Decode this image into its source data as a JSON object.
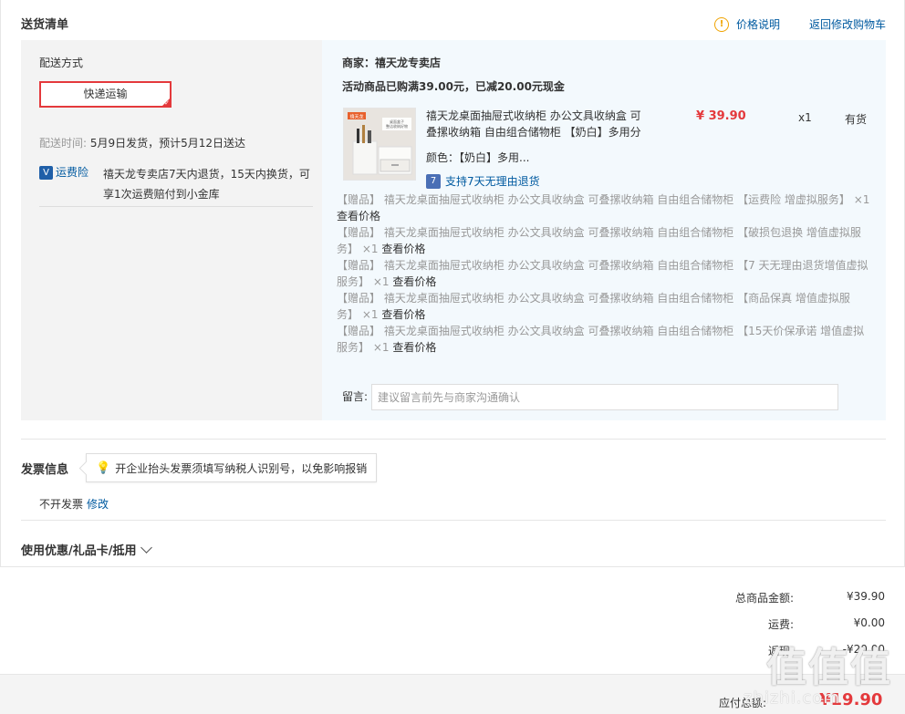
{
  "header": {
    "title": "送货清单",
    "price_info": "价格说明",
    "back_cart": "返回修改购物车"
  },
  "shipping": {
    "label": "配送方式",
    "method": "快递运输",
    "time_label": "配送时间:",
    "time_value": "5月9日发货，预计5月12日送达",
    "fee_icon": "V",
    "fee_label": "运费险",
    "fee_text": "禧天龙专卖店7天内退货，15天内换货，可享1次运费赔付到小金库"
  },
  "order": {
    "merchant": "商家：禧天龙专卖店",
    "promo": "活动商品已购满39.00元，已减20.00元现金",
    "product": {
      "name": "禧天龙桌面抽屉式收纳柜 办公文具收纳盒 可叠摞收纳箱 自由组合储物柜 【奶白】多用分",
      "price": "¥ 39.90",
      "qty": "x1",
      "stock": "有货",
      "color": "颜色：【奶白】多用...",
      "return": "支持7天无理由退货",
      "img_brand": "禧天龙",
      "img_caption": "桌面盒子 整洁收纳好物"
    },
    "gifts": [
      {
        "text": "【赠品】 禧天龙桌面抽屉式收纳柜 办公文具收纳盒 可叠摞收纳箱 自由组合储物柜 【运费险 增虚拟服务】 ×1",
        "link": "查看价格"
      },
      {
        "text": "【赠品】 禧天龙桌面抽屉式收纳柜 办公文具收纳盒 可叠摞收纳箱 自由组合储物柜 【破损包退换 增值虚拟服务】 ×1",
        "link": "查看价格"
      },
      {
        "text": "【赠品】 禧天龙桌面抽屉式收纳柜 办公文具收纳盒 可叠摞收纳箱 自由组合储物柜 【7 天无理由退货增值虚拟服务】 ×1",
        "link": "查看价格"
      },
      {
        "text": "【赠品】 禧天龙桌面抽屉式收纳柜 办公文具收纳盒 可叠摞收纳箱 自由组合储物柜 【商品保真 增值虚拟服务】 ×1",
        "link": "查看价格"
      },
      {
        "text": "【赠品】 禧天龙桌面抽屉式收纳柜 办公文具收纳盒 可叠摞收纳箱 自由组合储物柜 【15天价保承诺 增值虚拟服务】 ×1",
        "link": "查看价格"
      }
    ],
    "message_label": "留言:",
    "message_placeholder": "建议留言前先与商家沟通确认"
  },
  "invoice": {
    "title": "发票信息",
    "tip": "开企业抬头发票须填写纳税人识别号，以免影响报销",
    "status": "不开发票",
    "edit": "修改"
  },
  "coupon": {
    "title": "使用优惠/礼品卡/抵用"
  },
  "summary": {
    "goods_label": "总商品金额:",
    "goods_value": "¥39.90",
    "freight_label": "运费:",
    "freight_value": "¥0.00",
    "cashback_label": "返现:",
    "cashback_value": "-¥20.00",
    "total_label": "应付总额:",
    "total_value": "¥19.90"
  },
  "watermark": {
    "main": "值值值",
    "sub": "zhizhi.com"
  },
  "colors": {
    "accent_red": "#e4393c",
    "link_blue": "#005aa0"
  }
}
